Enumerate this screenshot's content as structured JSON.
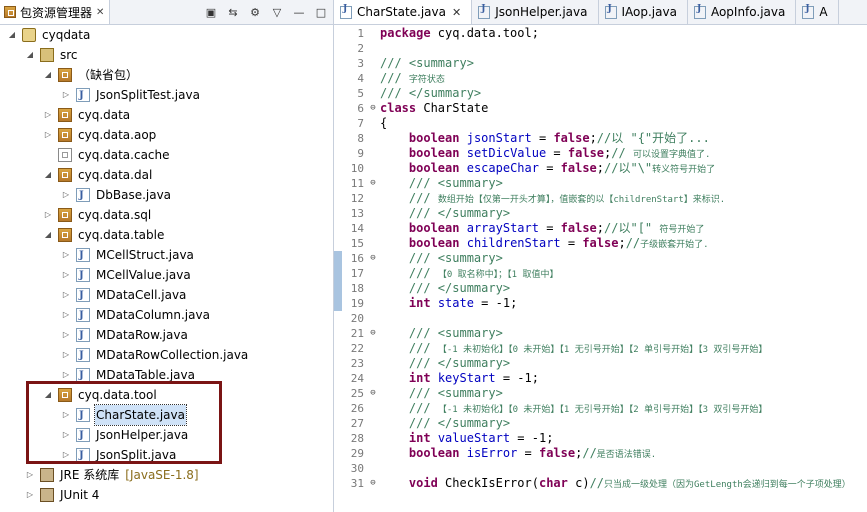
{
  "explorer": {
    "tab_label": "包资源管理器",
    "tree": [
      {
        "label": "cyqdata",
        "icon": "project-icon",
        "twisty": "▲",
        "indent": 0
      },
      {
        "label": "src",
        "icon": "source-folder-icon",
        "twisty": "▲",
        "indent": 1
      },
      {
        "label": "（缺省包）",
        "icon": "package-icon",
        "twisty": "▲",
        "indent": 2
      },
      {
        "label": "JsonSplitTest.java",
        "icon": "java-file-icon",
        "twisty": "▷",
        "indent": 3
      },
      {
        "label": "cyq.data",
        "icon": "package-icon",
        "twisty": "▷",
        "indent": 2
      },
      {
        "label": "cyq.data.aop",
        "icon": "package-icon",
        "twisty": "▷",
        "indent": 2
      },
      {
        "label": "cyq.data.cache",
        "icon": "empty-package-icon",
        "twisty": "",
        "indent": 2
      },
      {
        "label": "cyq.data.dal",
        "icon": "package-icon",
        "twisty": "▲",
        "indent": 2
      },
      {
        "label": "DbBase.java",
        "icon": "java-file-icon",
        "twisty": "▷",
        "indent": 3
      },
      {
        "label": "cyq.data.sql",
        "icon": "package-icon",
        "twisty": "▷",
        "indent": 2
      },
      {
        "label": "cyq.data.table",
        "icon": "package-icon",
        "twisty": "▲",
        "indent": 2
      },
      {
        "label": "MCellStruct.java",
        "icon": "java-file-icon",
        "twisty": "▷",
        "indent": 3
      },
      {
        "label": "MCellValue.java",
        "icon": "java-file-icon",
        "twisty": "▷",
        "indent": 3
      },
      {
        "label": "MDataCell.java",
        "icon": "java-file-icon",
        "twisty": "▷",
        "indent": 3
      },
      {
        "label": "MDataColumn.java",
        "icon": "java-file-icon",
        "twisty": "▷",
        "indent": 3
      },
      {
        "label": "MDataRow.java",
        "icon": "java-file-icon",
        "twisty": "▷",
        "indent": 3
      },
      {
        "label": "MDataRowCollection.java",
        "icon": "java-file-icon",
        "twisty": "▷",
        "indent": 3
      },
      {
        "label": "MDataTable.java",
        "icon": "java-file-icon",
        "twisty": "▷",
        "indent": 3
      },
      {
        "label": "cyq.data.tool",
        "icon": "package-icon",
        "twisty": "▲",
        "indent": 2
      },
      {
        "label": "CharState.java",
        "icon": "java-file-icon",
        "twisty": "▷",
        "indent": 3,
        "selected": true
      },
      {
        "label": "JsonHelper.java",
        "icon": "java-file-icon",
        "twisty": "▷",
        "indent": 3
      },
      {
        "label": "JsonSplit.java",
        "icon": "java-file-icon",
        "twisty": "▷",
        "indent": 3
      },
      {
        "label": "JRE 系统库",
        "suffix": "[JavaSE-1.8]",
        "icon": "library-icon",
        "twisty": "▷",
        "indent": 1
      },
      {
        "label": "JUnit 4",
        "icon": "library-icon",
        "twisty": "▷",
        "indent": 1
      }
    ]
  },
  "editor": {
    "tabs": [
      {
        "label": "CharState.java",
        "active": true,
        "closable": true
      },
      {
        "label": "JsonHelper.java"
      },
      {
        "label": "IAop.java"
      },
      {
        "label": "AopInfo.java"
      },
      {
        "label": "A"
      }
    ],
    "lines": [
      {
        "n": "1",
        "fold": "",
        "parts": [
          [
            "kw",
            "package"
          ],
          [
            "t",
            " cyq.data.tool;"
          ]
        ]
      },
      {
        "n": "2",
        "fold": "",
        "parts": []
      },
      {
        "n": "3",
        "fold": "",
        "parts": [
          [
            "cm",
            "/// <summary>"
          ]
        ]
      },
      {
        "n": "4",
        "fold": "",
        "parts": [
          [
            "cm",
            "/// "
          ],
          [
            "cmz",
            "字符状态"
          ]
        ]
      },
      {
        "n": "5",
        "fold": "",
        "parts": [
          [
            "cm",
            "/// </summary>"
          ]
        ]
      },
      {
        "n": "6",
        "fold": "⊖",
        "parts": [
          [
            "kw",
            "class"
          ],
          [
            "t",
            " CharState"
          ]
        ]
      },
      {
        "n": "7",
        "fold": "",
        "parts": [
          [
            "t",
            "{"
          ]
        ]
      },
      {
        "n": "8",
        "fold": "",
        "parts": [
          [
            "t",
            "    "
          ],
          [
            "kw",
            "boolean"
          ],
          [
            "t",
            " "
          ],
          [
            "fd",
            "jsonStart"
          ],
          [
            "t",
            " = "
          ],
          [
            "kw",
            "false"
          ],
          [
            "t",
            ";"
          ],
          [
            "cm",
            "//以 \"{\"开始了..."
          ]
        ]
      },
      {
        "n": "9",
        "fold": "",
        "parts": [
          [
            "t",
            "    "
          ],
          [
            "kw",
            "boolean"
          ],
          [
            "t",
            " "
          ],
          [
            "fd",
            "setDicValue"
          ],
          [
            "t",
            " = "
          ],
          [
            "kw",
            "false"
          ],
          [
            "t",
            ";"
          ],
          [
            "cm",
            "// "
          ],
          [
            "cmz",
            "可以设置字典值了."
          ]
        ]
      },
      {
        "n": "10",
        "fold": "",
        "parts": [
          [
            "t",
            "    "
          ],
          [
            "kw",
            "boolean"
          ],
          [
            "t",
            " "
          ],
          [
            "fd",
            "escapeChar"
          ],
          [
            "t",
            " = "
          ],
          [
            "kw",
            "false"
          ],
          [
            "t",
            ";"
          ],
          [
            "cm",
            "//以\"\\\""
          ],
          [
            "cmz",
            "转义符号开始了"
          ]
        ]
      },
      {
        "n": "11",
        "fold": "⊖",
        "parts": [
          [
            "t",
            "    "
          ],
          [
            "cm",
            "/// <summary>"
          ]
        ]
      },
      {
        "n": "12",
        "fold": "",
        "parts": [
          [
            "t",
            "    "
          ],
          [
            "cm",
            "/// "
          ],
          [
            "cmz",
            "数组开始【仅第一开头才算】，值嵌套的以【childrenStart】来标识."
          ]
        ]
      },
      {
        "n": "13",
        "fold": "",
        "parts": [
          [
            "t",
            "    "
          ],
          [
            "cm",
            "/// </summary>"
          ]
        ]
      },
      {
        "n": "14",
        "fold": "",
        "parts": [
          [
            "t",
            "    "
          ],
          [
            "kw",
            "boolean"
          ],
          [
            "t",
            " "
          ],
          [
            "fd",
            "arrayStart"
          ],
          [
            "t",
            " = "
          ],
          [
            "kw",
            "false"
          ],
          [
            "t",
            ";"
          ],
          [
            "cm",
            "//以\"[\" "
          ],
          [
            "cmz",
            "符号开始了"
          ]
        ]
      },
      {
        "n": "15",
        "fold": "",
        "parts": [
          [
            "t",
            "    "
          ],
          [
            "kw",
            "boolean"
          ],
          [
            "t",
            " "
          ],
          [
            "fd",
            "childrenStart"
          ],
          [
            "t",
            " = "
          ],
          [
            "kw",
            "false"
          ],
          [
            "t",
            ";"
          ],
          [
            "cm",
            "//"
          ],
          [
            "cmz",
            "子级嵌套开始了."
          ]
        ]
      },
      {
        "n": "16",
        "fold": "⊖",
        "marker": true,
        "parts": [
          [
            "t",
            "    "
          ],
          [
            "cm",
            "/// <summary>"
          ]
        ]
      },
      {
        "n": "17",
        "fold": "",
        "marker": true,
        "parts": [
          [
            "t",
            "    "
          ],
          [
            "cm",
            "/// "
          ],
          [
            "cmz",
            "【0 取名称中】；【1 取值中】"
          ]
        ]
      },
      {
        "n": "18",
        "fold": "",
        "marker": true,
        "parts": [
          [
            "t",
            "    "
          ],
          [
            "cm",
            "/// </summary>"
          ]
        ]
      },
      {
        "n": "19",
        "fold": "",
        "marker": true,
        "parts": [
          [
            "t",
            "    "
          ],
          [
            "kw",
            "int"
          ],
          [
            "t",
            " "
          ],
          [
            "fd",
            "state"
          ],
          [
            "t",
            " = -1;"
          ]
        ]
      },
      {
        "n": "20",
        "fold": "",
        "parts": []
      },
      {
        "n": "21",
        "fold": "⊖",
        "parts": [
          [
            "t",
            "    "
          ],
          [
            "cm",
            "/// <summary>"
          ]
        ]
      },
      {
        "n": "22",
        "fold": "",
        "parts": [
          [
            "t",
            "    "
          ],
          [
            "cm",
            "/// "
          ],
          [
            "cmz",
            "【-1 未初始化】【0 未开始】【1 无引号开始】【2 单引号开始】【3 双引号开始】"
          ]
        ]
      },
      {
        "n": "23",
        "fold": "",
        "parts": [
          [
            "t",
            "    "
          ],
          [
            "cm",
            "/// </summary>"
          ]
        ]
      },
      {
        "n": "24",
        "fold": "",
        "parts": [
          [
            "t",
            "    "
          ],
          [
            "kw",
            "int"
          ],
          [
            "t",
            " "
          ],
          [
            "fd",
            "keyStart"
          ],
          [
            "t",
            " = -1;"
          ]
        ]
      },
      {
        "n": "25",
        "fold": "⊖",
        "parts": [
          [
            "t",
            "    "
          ],
          [
            "cm",
            "/// <summary>"
          ]
        ]
      },
      {
        "n": "26",
        "fold": "",
        "parts": [
          [
            "t",
            "    "
          ],
          [
            "cm",
            "/// "
          ],
          [
            "cmz",
            "【-1 未初始化】【0 未开始】【1 无引号开始】【2 单引号开始】【3 双引号开始】"
          ]
        ]
      },
      {
        "n": "27",
        "fold": "",
        "parts": [
          [
            "t",
            "    "
          ],
          [
            "cm",
            "/// </summary>"
          ]
        ]
      },
      {
        "n": "28",
        "fold": "",
        "parts": [
          [
            "t",
            "    "
          ],
          [
            "kw",
            "int"
          ],
          [
            "t",
            " "
          ],
          [
            "fd",
            "valueStart"
          ],
          [
            "t",
            " = -1;"
          ]
        ]
      },
      {
        "n": "29",
        "fold": "",
        "parts": [
          [
            "t",
            "    "
          ],
          [
            "kw",
            "boolean"
          ],
          [
            "t",
            " "
          ],
          [
            "fd",
            "isError"
          ],
          [
            "t",
            " = "
          ],
          [
            "kw",
            "false"
          ],
          [
            "t",
            ";"
          ],
          [
            "cm",
            "//"
          ],
          [
            "cmz",
            "是否语法错误."
          ]
        ]
      },
      {
        "n": "30",
        "fold": "",
        "parts": []
      },
      {
        "n": "31",
        "fold": "⊖",
        "parts": [
          [
            "t",
            "    "
          ],
          [
            "kw",
            "void"
          ],
          [
            "t",
            " CheckIsError("
          ],
          [
            "kw",
            "char"
          ],
          [
            "t",
            " c)"
          ],
          [
            "cm",
            "//"
          ],
          [
            "cmz",
            "只当成一级处理（因为GetLength会递归到每一个子项处理）"
          ]
        ]
      }
    ]
  }
}
